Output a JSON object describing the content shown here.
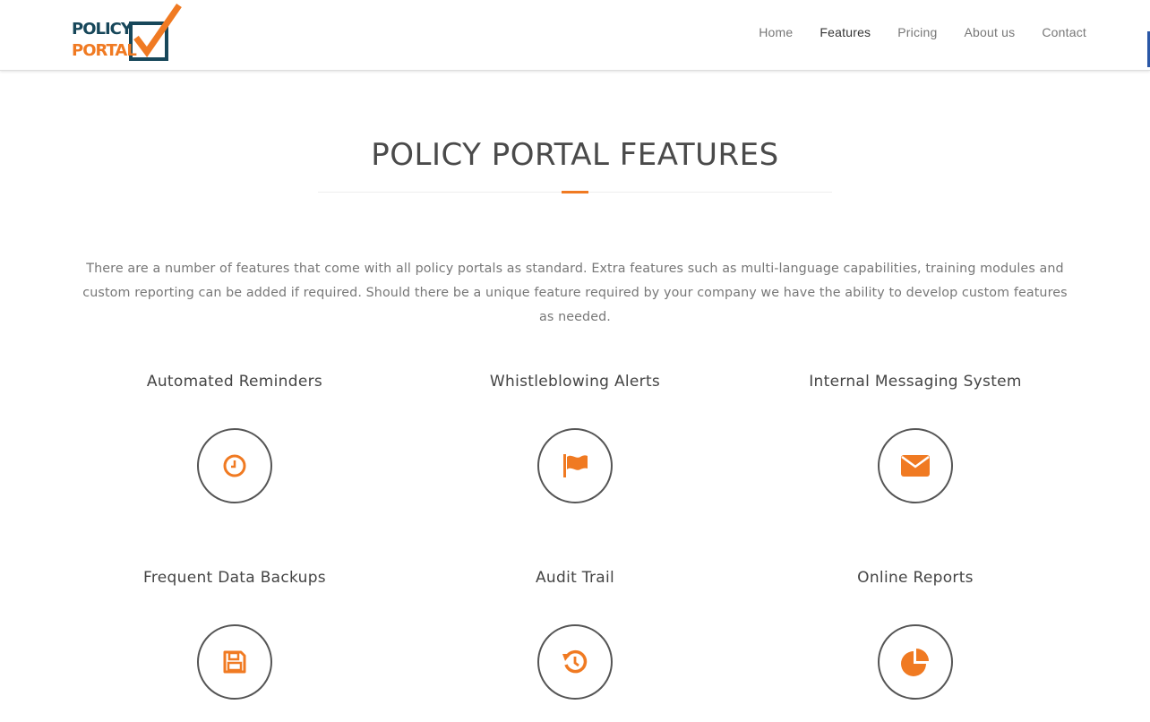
{
  "header": {
    "logo": {
      "line1": "POLICY",
      "line2": "PORTAL"
    },
    "nav": [
      {
        "label": "Home"
      },
      {
        "label": "Features"
      },
      {
        "label": "Pricing"
      },
      {
        "label": "About us"
      },
      {
        "label": "Contact"
      }
    ],
    "active_nav": "Features"
  },
  "main": {
    "title": "POLICY PORTAL FEATURES",
    "intro": "There are a number of features that come with all policy portals as standard. Extra features such as multi-language capabilities, training modules and custom reporting can be added if required. Should there be a unique feature required by your company we have the ability to develop custom features as needed.",
    "features": [
      {
        "title": "Automated Reminders",
        "icon": "clock-icon"
      },
      {
        "title": "Whistleblowing Alerts",
        "icon": "flag-icon"
      },
      {
        "title": "Internal Messaging System",
        "icon": "envelope-icon"
      },
      {
        "title": "Frequent Data Backups",
        "icon": "floppy-disk-icon"
      },
      {
        "title": "Audit Trail",
        "icon": "history-icon"
      },
      {
        "title": "Online Reports",
        "icon": "pie-chart-icon"
      }
    ]
  },
  "colors": {
    "accent": "#f07a22",
    "logo_dark": "#17475a",
    "heading": "#4a4a4a",
    "body_text": "#777777",
    "nav_edge": "#2a57a6"
  }
}
